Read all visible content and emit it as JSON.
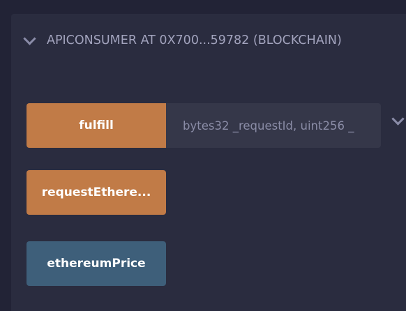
{
  "contract": {
    "title": "APICONSUMER AT 0X700...59782 (BLOCKCHAIN)"
  },
  "functions": [
    {
      "label": "fulfill",
      "params_placeholder": "bytes32 _requestId, uint256 _"
    },
    {
      "label": "requestEthere..."
    },
    {
      "label": "ethereumPrice"
    }
  ],
  "colors": {
    "transact": "#c17b47",
    "call": "#3e5f7a"
  }
}
